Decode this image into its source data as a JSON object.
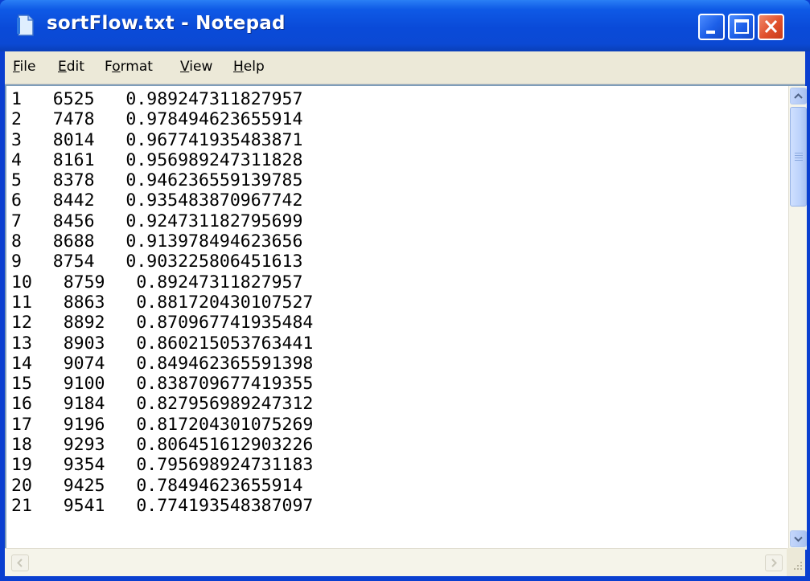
{
  "window": {
    "title": "sortFlow.txt - Notepad",
    "icon": "notepad-icon"
  },
  "menu": {
    "file": "ile",
    "file_accel": "F",
    "edit": "dit",
    "edit_accel": "E",
    "format_pre": "F",
    "format_accel": "o",
    "format_post": "rmat",
    "view": "iew",
    "view_accel": "V",
    "help": "elp",
    "help_accel": "H"
  },
  "document": {
    "lines": [
      "1   6525   0.989247311827957",
      "2   7478   0.978494623655914",
      "3   8014   0.967741935483871",
      "4   8161   0.956989247311828",
      "5   8378   0.946236559139785",
      "6   8442   0.935483870967742",
      "7   8456   0.924731182795699",
      "8   8688   0.913978494623656",
      "9   8754   0.903225806451613",
      "10   8759   0.89247311827957",
      "11   8863   0.881720430107527",
      "12   8892   0.870967741935484",
      "13   8903   0.860215053763441",
      "14   9074   0.849462365591398",
      "15   9100   0.838709677419355",
      "16   9184   0.827956989247312",
      "17   9196   0.817204301075269",
      "18   9293   0.806451612903226",
      "19   9354   0.795698924731183",
      "20   9425   0.78494623655914",
      "21   9541   0.774193548387097"
    ]
  },
  "colors": {
    "title_bar": "#0b49d4",
    "menu_bg": "#ece9d8",
    "close_button": "#e0502c"
  }
}
